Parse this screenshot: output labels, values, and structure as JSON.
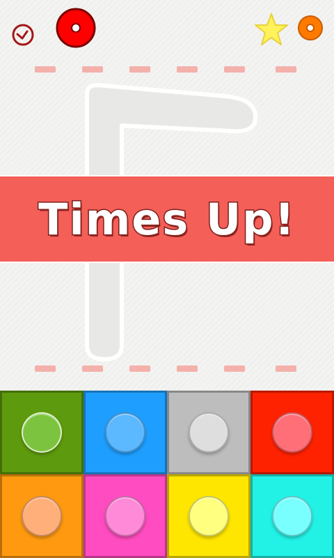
{
  "hud": {
    "timer_icon": "clock-icon",
    "current_color": "#ff0000",
    "star_icon": "star-icon",
    "coin_icon": "coin-icon",
    "star_color": "#fff25a",
    "coin_color": "#ff7a00"
  },
  "banner": {
    "text": "Times Up!",
    "background": "#f45f58"
  },
  "guide": {
    "dash_color": "#f4b0aa",
    "trace_color": "#e8e8e6"
  },
  "palette": [
    {
      "name": "green",
      "tile": "#5e9a0d",
      "button": "#7cc43f",
      "selected": true
    },
    {
      "name": "blue",
      "tile": "#1e9fff",
      "button": "#5cb8ff",
      "selected": false
    },
    {
      "name": "gray",
      "tile": "#bdbdbd",
      "button": "#dedede",
      "selected": false
    },
    {
      "name": "red",
      "tile": "#ff2200",
      "button": "#ff6f78",
      "selected": false
    },
    {
      "name": "orange",
      "tile": "#ff9a10",
      "button": "#ffb07a",
      "selected": false
    },
    {
      "name": "pink",
      "tile": "#ff4cc0",
      "button": "#ff8ad8",
      "selected": false
    },
    {
      "name": "yellow",
      "tile": "#ffe600",
      "button": "#ffff80",
      "selected": false
    },
    {
      "name": "cyan",
      "tile": "#22f2e6",
      "button": "#7affff",
      "selected": false
    }
  ]
}
